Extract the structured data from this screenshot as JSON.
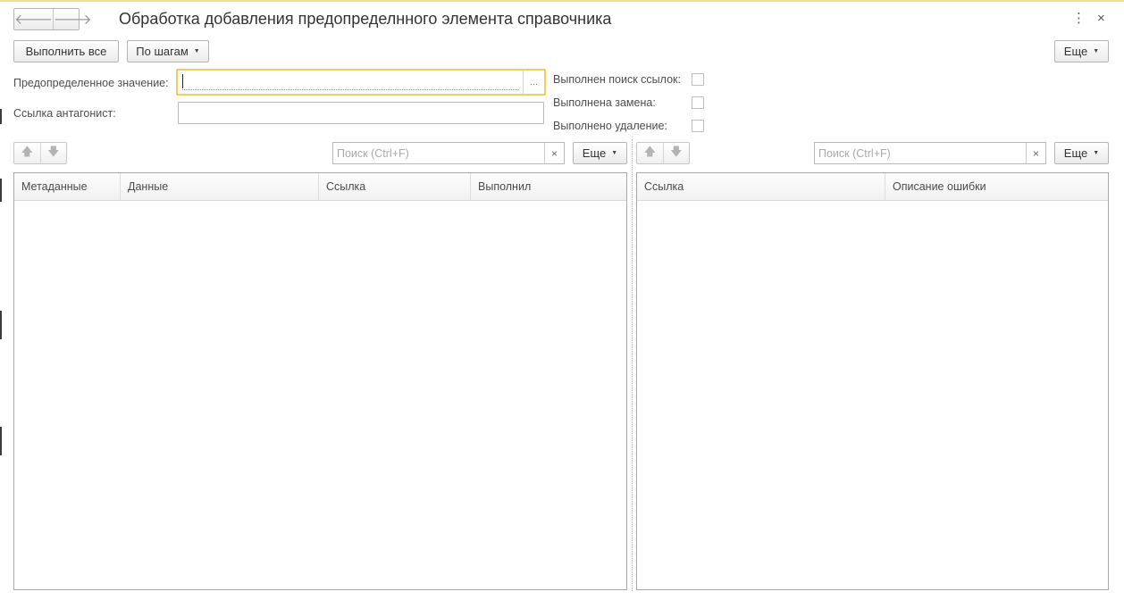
{
  "window": {
    "title": "Обработка добавления предопределнного элемента справочника",
    "back_glyph": "🡐",
    "forward_glyph": "🡒",
    "menu_glyph": "⋮",
    "close_glyph": "×"
  },
  "toolbar": {
    "run_all_label": "Выполнить все",
    "step_label": "По шагам",
    "more_label": "Еще"
  },
  "form": {
    "predefined_label": "Предопределенное значение:",
    "predefined_value": "",
    "choose_glyph": "...",
    "antagonist_label": "Ссылка антагонист:",
    "antagonist_value": "",
    "checks": {
      "search_done_label": "Выполнен поиск ссылок:",
      "search_done": false,
      "replace_done_label": "Выполнена замена:",
      "replace_done": false,
      "delete_done_label": "Выполнено удаление:",
      "delete_done": false
    }
  },
  "left_table": {
    "up_glyph": "🡅",
    "down_glyph": "🡇",
    "search_placeholder": "Поиск (Ctrl+F)",
    "clear_glyph": "×",
    "more_label": "Еще",
    "columns": [
      "Метаданные",
      "Данные",
      "Ссылка",
      "Выполнил"
    ],
    "rows": []
  },
  "right_table": {
    "up_glyph": "🡅",
    "down_glyph": "🡇",
    "search_placeholder": "Поиск (Ctrl+F)",
    "clear_glyph": "×",
    "more_label": "Еще",
    "columns": [
      "Ссылка",
      "Описание ошибки"
    ],
    "rows": []
  },
  "colors": {
    "focus_border": "#f3cc5a",
    "border": "#b9b9b9",
    "header_bg": "#f2f2f2"
  }
}
